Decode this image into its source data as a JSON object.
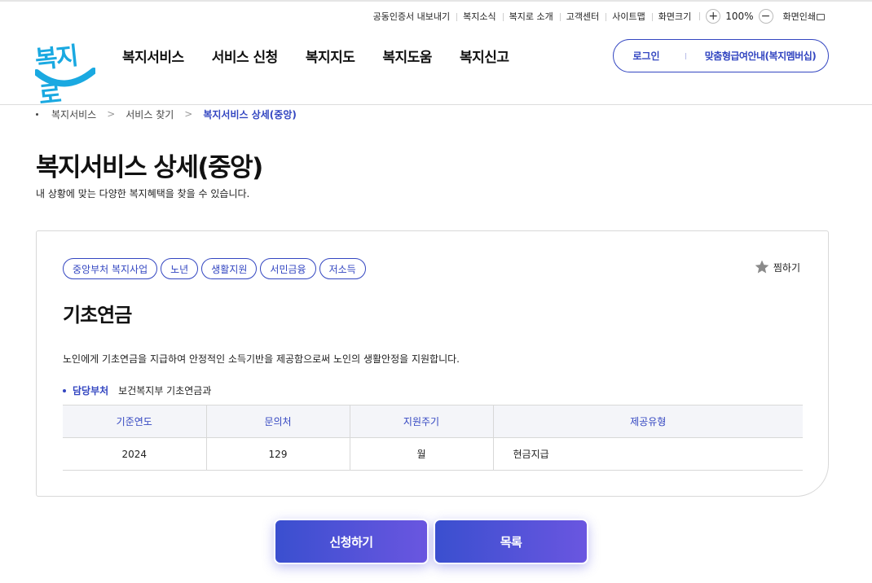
{
  "utility": {
    "links": [
      "공동인증서 내보내기",
      "복지소식",
      "복지로 소개",
      "고객센터",
      "사이트맵",
      "화면크기"
    ],
    "zoom_in": "+",
    "zoom_value": "100%",
    "zoom_out": "−",
    "print": "화면인쇄"
  },
  "logo": {
    "text": "복지로"
  },
  "gnb": {
    "items": [
      "복지서비스",
      "서비스 신청",
      "복지지도",
      "복지도움",
      "복지신고"
    ]
  },
  "auth": {
    "login": "로그인",
    "custom": "맞춤형급여안내(복지멤버십)"
  },
  "breadcrumb": {
    "items": [
      "복지서비스",
      "서비스 찾기"
    ],
    "current": "복지서비스 상세(중앙)",
    "separator": ">"
  },
  "page": {
    "title": "복지서비스 상세(중앙)",
    "subtitle": "내 상황에 맞는 다양한 복지혜택을 찾을 수 있습니다."
  },
  "service": {
    "tags": [
      "중앙부처 복지사업",
      "노년",
      "생활지원",
      "서민금융",
      "저소득"
    ],
    "favorite": "찜하기",
    "name": "기초연금",
    "description": "노인에게 기초연금을 지급하여 안정적인 소득기반을 제공함으로써 노인의 생활안정을 지원합니다.",
    "dept_label": "담당부처",
    "dept_value": "보건복지부 기초연금과",
    "table": {
      "headers": [
        "기준연도",
        "문의처",
        "지원주기",
        "제공유형"
      ],
      "row": [
        "2024",
        "129",
        "월",
        "현금지급"
      ]
    }
  },
  "buttons": {
    "apply": "신청하기",
    "list": "목록"
  },
  "colors": {
    "accent": "#3346c1",
    "logo": "#1aa9e1",
    "button_start": "#3a4fcf",
    "button_end": "#6a56e0"
  }
}
